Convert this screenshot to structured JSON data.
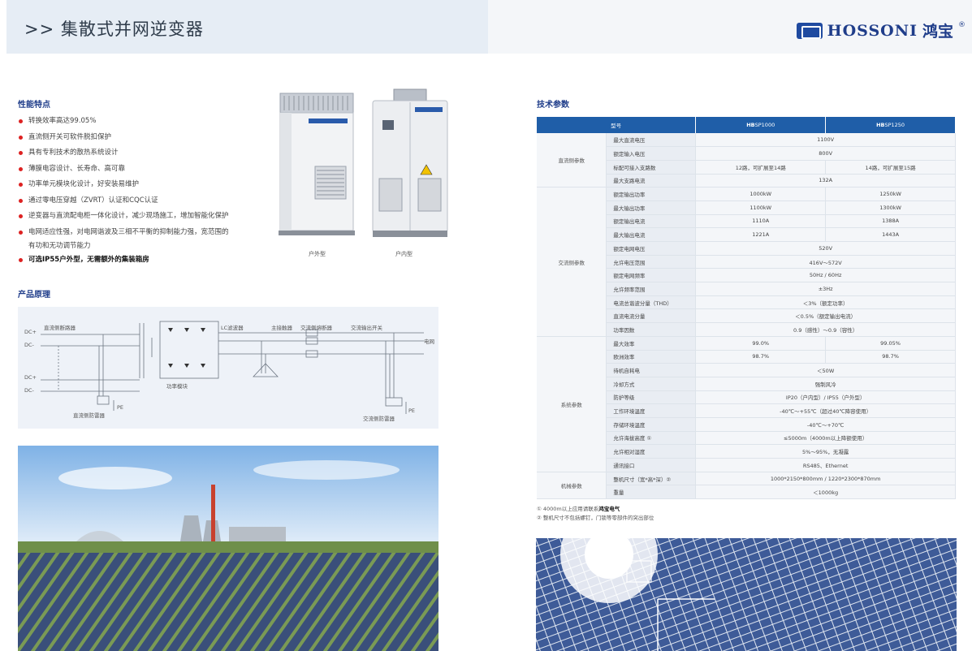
{
  "header": {
    "title": ">> 集散式并网逆变器",
    "logo_text": "HOSSONI",
    "logo_cn": "鸿宝",
    "logo_reg": "®"
  },
  "features": {
    "title": "性能特点",
    "items": [
      "转换效率高达99.05%",
      "直流侧开关可软件脱扣保护",
      "具有专利技术的散热系统设计",
      "薄膜电容设计、长寿命、高可靠",
      "功率单元模块化设计，好安装易维护",
      "通过零电压穿越（ZVRT）认证和CQC认证",
      "逆变器与直流配电柜一体化设计，减少现场施工，增加智能化保护",
      "电网适应性强，对电网谐波及三相不平衡的抑制能力强，宽范围的"
    ],
    "item_continuation": "有功和无功调节能力",
    "highlight": "可选IP55户外型，无需额外的集装箱房"
  },
  "cabinets": {
    "outdoor_label": "户外型",
    "indoor_label": "户内型",
    "badge": "HOSSONI 鸿宝"
  },
  "principle": {
    "title": "产品原理",
    "labels": {
      "dcp1": "DC+",
      "dcm1": "DC-",
      "dcp2": "DC+",
      "dcm2": "DC-",
      "dc_breaker": "直流侧断路器",
      "lc": "LC滤波器",
      "contactor": "主接触器",
      "ac_breaker": "交流侧熔断器",
      "ac_switch": "交流输出开关",
      "grid": "电网",
      "power_module": "功率模块",
      "dc_surge": "直流侧防雷器",
      "ac_surge": "交流侧防雷器",
      "pe1": "PE",
      "pe2": "PE"
    }
  },
  "spec": {
    "title": "技术参数",
    "header": {
      "model": "型号",
      "m1_bold": "HB",
      "m1_rest": "SP1000",
      "m2_bold": "HB",
      "m2_rest": "SP1250"
    },
    "groups": [
      {
        "name": "直流侧参数",
        "rows": [
          [
            "最大直流电压",
            "1100V"
          ],
          [
            "额定输入电压",
            "800V"
          ],
          [
            "标配可接入支路数",
            "12路，可扩展至14路",
            "14路，可扩展至15路"
          ],
          [
            "最大支路电流",
            "132A"
          ]
        ]
      },
      {
        "name": "交流侧参数",
        "rows": [
          [
            "额定输出功率",
            "1000kW",
            "1250kW"
          ],
          [
            "最大输出功率",
            "1100kW",
            "1300kW"
          ],
          [
            "额定输出电流",
            "1110A",
            "1388A"
          ],
          [
            "最大输出电流",
            "1221A",
            "1443A"
          ],
          [
            "额定电网电压",
            "520V"
          ],
          [
            "允许电压范围",
            "416V～572V"
          ],
          [
            "额定电网频率",
            "50Hz / 60Hz"
          ],
          [
            "允许频率范围",
            "±3Hz"
          ],
          [
            "电流总谐波分量（THD）",
            "＜3%（额定功率）"
          ],
          [
            "直流电流分量",
            "＜0.5%（额定输出电流）"
          ],
          [
            "功率因数",
            "0.9（感性）～0.9（容性）"
          ]
        ]
      },
      {
        "name": "系统参数",
        "rows": [
          [
            "最大效率",
            "99.0%",
            "99.05%"
          ],
          [
            "欧洲效率",
            "98.7%",
            "98.7%"
          ],
          [
            "待机自耗电",
            "＜50W"
          ],
          [
            "冷却方式",
            "强制风冷"
          ],
          [
            "防护等级",
            "IP20（户内型）/ IP55（户外型）"
          ],
          [
            "工作环境温度",
            "-40℃～+55℃（超过40℃降容使用）"
          ],
          [
            "存储环境温度",
            "-40℃～+70℃"
          ],
          [
            "允许海拔高度 ①",
            "≤5000m（4000m以上降额使用）"
          ],
          [
            "允许相对湿度",
            "5%～95%，无凝露"
          ],
          [
            "通讯接口",
            "RS485、Ethernet"
          ]
        ]
      },
      {
        "name": "机械参数",
        "rows": [
          [
            "整机尺寸（宽*高*深）②",
            "1000*2150*800mm / 1220*2300*870mm"
          ],
          [
            "重量",
            "＜1000kg"
          ]
        ]
      }
    ],
    "note1_a": "① 4000m以上应用请联系",
    "note1_b": "鸿宝电气",
    "note2": "② 整机尺寸不包括螺钉，门锁等零部件的突出部位"
  },
  "colors": {
    "brand": "#1f3d8a",
    "table_header": "#1f5ea8",
    "bullet": "#d22222"
  }
}
